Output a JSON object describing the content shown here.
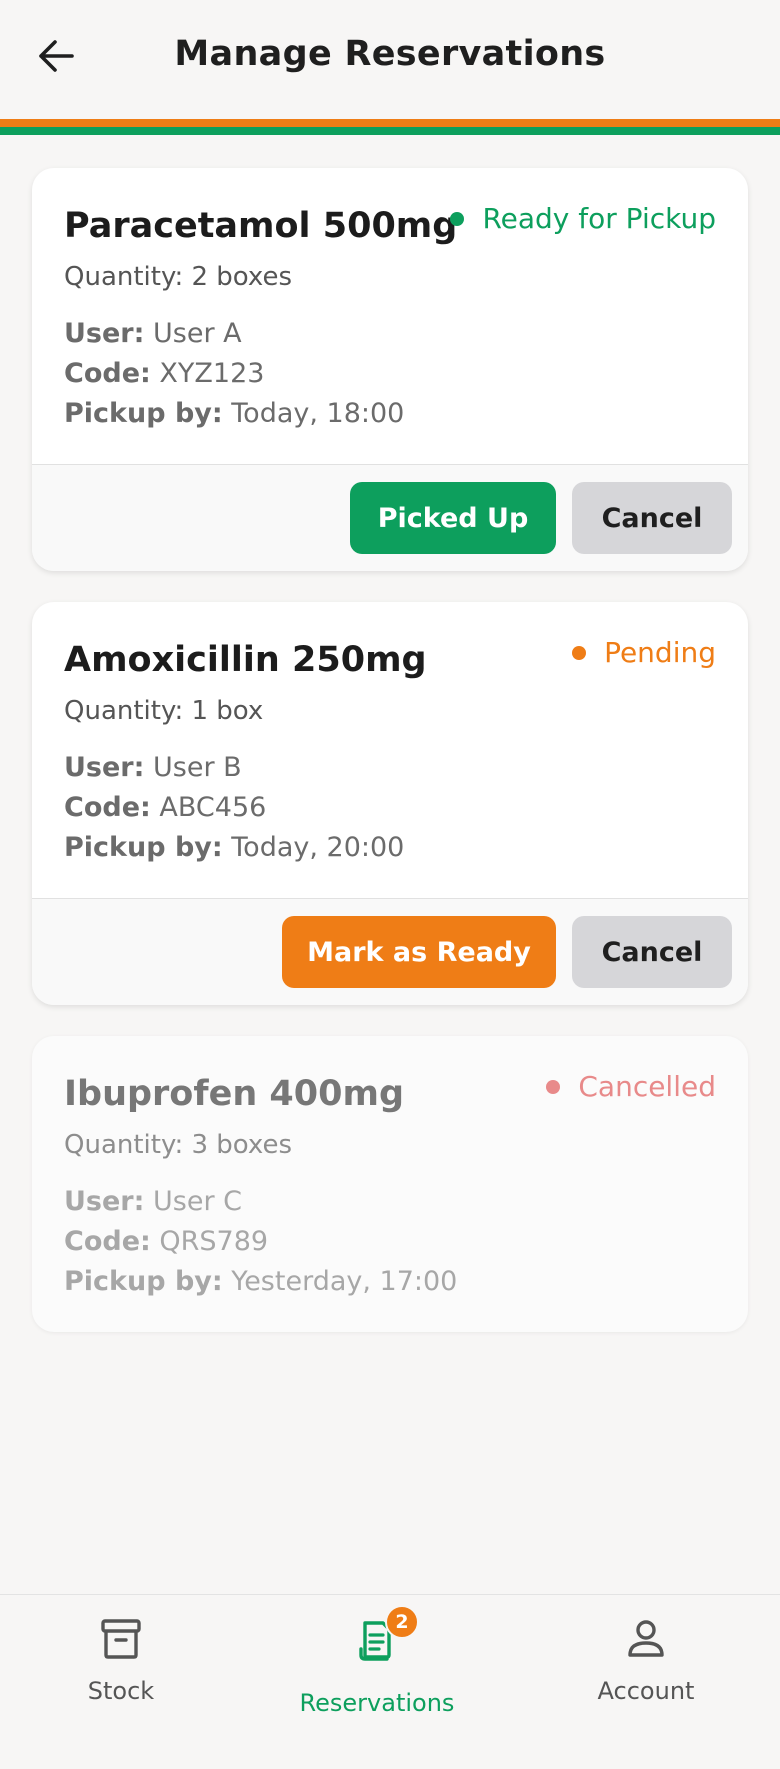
{
  "header": {
    "title": "Manage Reservations",
    "back_icon": "arrow-left-icon"
  },
  "colors": {
    "primary_green": "#0d9f5d",
    "accent_orange": "#ef7d16",
    "cancel_red": "#e88a8a",
    "cancel_button_gray": "#d6d6d9"
  },
  "reservations": [
    {
      "name": "Paracetamol 500mg",
      "quantity": "Quantity: 2 boxes",
      "user_label": "User:",
      "user": "User A",
      "code_label": "Code:",
      "code": "XYZ123",
      "pickup_label": "Pickup by:",
      "pickup": "Today, 18:00",
      "status": "Ready for Pickup",
      "status_color": "#0d9f5d",
      "primary_action": "Picked Up",
      "cancel_action": "Cancel"
    },
    {
      "name": "Amoxicillin 250mg",
      "quantity": "Quantity: 1 box",
      "user_label": "User:",
      "user": "User B",
      "code_label": "Code:",
      "code": "ABC456",
      "pickup_label": "Pickup by:",
      "pickup": "Today, 20:00",
      "status": "Pending",
      "status_color": "#ef7d16",
      "primary_action": "Mark as Ready",
      "cancel_action": "Cancel"
    },
    {
      "name": "Ibuprofen 400mg",
      "quantity": "Quantity: 3 boxes",
      "user_label": "User:",
      "user": "User C",
      "code_label": "Code:",
      "code": "QRS789",
      "pickup_label": "Pickup by:",
      "pickup": "Yesterday, 17:00",
      "status": "Cancelled",
      "status_color": "#e88a8a"
    }
  ],
  "bottom_nav": {
    "items": [
      {
        "label": "Stock",
        "icon": "archive-box-icon"
      },
      {
        "label": "Reservations",
        "icon": "receipt-icon",
        "badge": "2",
        "active": true
      },
      {
        "label": "Account",
        "icon": "person-icon"
      }
    ]
  }
}
